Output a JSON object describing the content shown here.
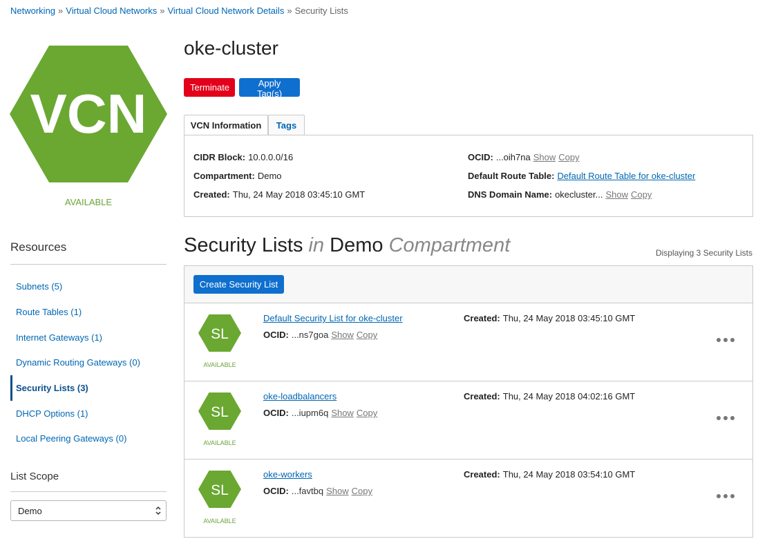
{
  "breadcrumb": {
    "items": [
      "Networking",
      "Virtual Cloud Networks",
      "Virtual Cloud Network Details"
    ],
    "current": "Security Lists",
    "separator": "»"
  },
  "vcn": {
    "badge": "VCN",
    "status": "AVAILABLE",
    "name": "oke-cluster"
  },
  "actions": {
    "terminate": "Terminate",
    "apply_tags": "Apply Tag(s)"
  },
  "tabs": {
    "info": "VCN Information",
    "tags": "Tags"
  },
  "info": {
    "cidr_label": "CIDR Block:",
    "cidr_value": "10.0.0.0/16",
    "compartment_label": "Compartment:",
    "compartment_value": "Demo",
    "created_label": "Created:",
    "created_value": "Thu, 24 May 2018 03:45:10 GMT",
    "ocid_label": "OCID:",
    "ocid_value": "...oih7na",
    "route_label": "Default Route Table:",
    "route_value": "Default Route Table for oke-cluster",
    "dns_label": "DNS Domain Name:",
    "dns_value": "okecluster...",
    "show": "Show",
    "copy": "Copy"
  },
  "resources": {
    "title": "Resources",
    "items": [
      "Subnets (5)",
      "Route Tables (1)",
      "Internet Gateways (1)",
      "Dynamic Routing Gateways (0)",
      "Security Lists (3)",
      "DHCP Options (1)",
      "Local Peering Gateways (0)"
    ]
  },
  "scope": {
    "title": "List Scope",
    "selected": "Demo"
  },
  "section": {
    "title_main": "Security Lists",
    "title_in": "in",
    "title_compartment": "Demo",
    "title_suffix": "Compartment",
    "count": "Displaying 3 Security Lists",
    "create_button": "Create Security List"
  },
  "security_lists": [
    {
      "badge": "SL",
      "status": "AVAILABLE",
      "name": "Default Security List for oke-cluster",
      "ocid_label": "OCID:",
      "ocid": "...ns7goa",
      "show": "Show",
      "copy": "Copy",
      "created_label": "Created:",
      "created": "Thu, 24 May 2018 03:45:10 GMT"
    },
    {
      "badge": "SL",
      "status": "AVAILABLE",
      "name": "oke-loadbalancers",
      "ocid_label": "OCID:",
      "ocid": "...iupm6q",
      "show": "Show",
      "copy": "Copy",
      "created_label": "Created:",
      "created": "Thu, 24 May 2018 04:02:16 GMT"
    },
    {
      "badge": "SL",
      "status": "AVAILABLE",
      "name": "oke-workers",
      "ocid_label": "OCID:",
      "ocid": "...favtbq",
      "show": "Show",
      "copy": "Copy",
      "created_label": "Created:",
      "created": "Thu, 24 May 2018 03:54:10 GMT"
    }
  ],
  "colors": {
    "accent": "#0f6fce",
    "link": "#0066b3",
    "danger": "#e2001a",
    "available": "#6aa336",
    "hex_green": "#6aa832"
  },
  "icons": {
    "vcn": "vcn-hexagon-icon",
    "sl": "security-list-hexagon-icon",
    "menu": "more-actions-icon",
    "select": "select-chevron-icon"
  }
}
